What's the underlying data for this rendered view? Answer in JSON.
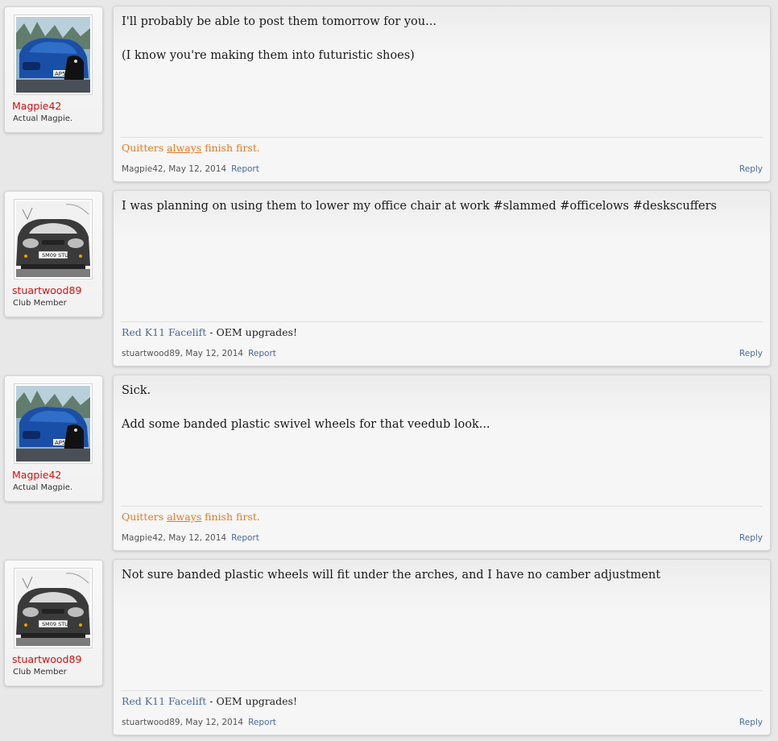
{
  "posts": [
    {
      "author": "Magpie42",
      "user_title": "Actual Magpie.",
      "avatar": "blue-car-avatar",
      "paragraphs": [
        "I'll probably be able to post them tomorrow for you...",
        "(I know you're making them into futuristic shoes)"
      ],
      "signature": {
        "style": "orange",
        "part1": "Quitters ",
        "part2": "always",
        "part3": " finish first."
      },
      "meta_author": "Magpie42,",
      "date": "May 12, 2014",
      "report_label": "Report",
      "reply_label": "Reply"
    },
    {
      "author": "stuartwood89",
      "user_title": "Club Member",
      "avatar": "grey-car-avatar",
      "paragraphs": [
        "I was planning on using them to lower my office chair at work #slammed #officelows #deskscuffers"
      ],
      "signature": {
        "style": "blue",
        "part1": "Red K11 Facelift",
        "part2": " - OEM upgrades!"
      },
      "meta_author": "stuartwood89,",
      "date": "May 12, 2014",
      "report_label": "Report",
      "reply_label": "Reply"
    },
    {
      "author": "Magpie42",
      "user_title": "Actual Magpie.",
      "avatar": "blue-car-avatar",
      "paragraphs": [
        "Sick.",
        "Add some banded plastic swivel wheels for that veedub look..."
      ],
      "signature": {
        "style": "orange",
        "part1": "Quitters ",
        "part2": "always",
        "part3": " finish first."
      },
      "meta_author": "Magpie42,",
      "date": "May 12, 2014",
      "report_label": "Report",
      "reply_label": "Reply"
    },
    {
      "author": "stuartwood89",
      "user_title": "Club Member",
      "avatar": "grey-car-avatar",
      "paragraphs": [
        "Not sure banded plastic wheels will fit under the arches, and I have no camber adjustment"
      ],
      "signature": {
        "style": "blue",
        "part1": "Red K11 Facelift",
        "part2": " - OEM upgrades!"
      },
      "meta_author": "stuartwood89,",
      "date": "May 12, 2014",
      "report_label": "Report",
      "reply_label": "Reply"
    }
  ]
}
